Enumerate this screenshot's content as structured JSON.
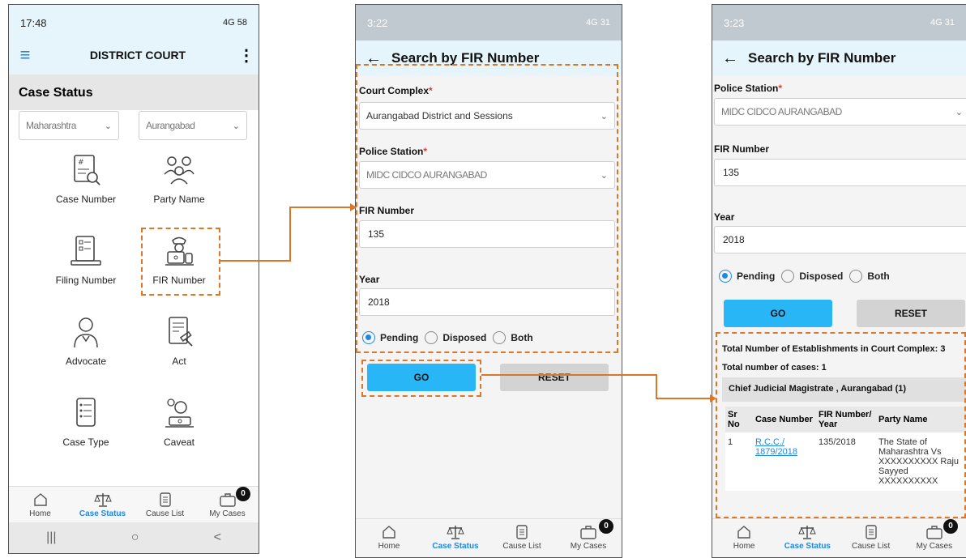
{
  "screen1": {
    "status_time": "17:48",
    "status_right": "4G 58",
    "app_title": "DISTRICT COURT",
    "section_title": "Case Status",
    "state_select": "Maharashtra",
    "district_select": "Aurangabad",
    "tiles": [
      {
        "label": "Case Number"
      },
      {
        "label": "Party Name"
      },
      {
        "label": "Filing Number"
      },
      {
        "label": "FIR Number"
      },
      {
        "label": "Advocate"
      },
      {
        "label": "Act"
      },
      {
        "label": "Case Type"
      },
      {
        "label": "Caveat"
      }
    ]
  },
  "nav": {
    "home": "Home",
    "case_status": "Case Status",
    "cause_list": "Cause List",
    "my_cases": "My Cases",
    "badge": "0"
  },
  "sysnav": {
    "recents": "|||",
    "home": "○",
    "back": "<"
  },
  "screen2": {
    "status_time": "3:22",
    "status_right": "4G 31",
    "title": "Search by FIR Number",
    "court_complex_label": "Court Complex",
    "court_complex_value": "Aurangabad District and Sessions",
    "police_station_label": "Police Station",
    "police_station_value": "MIDC CIDCO AURANGABAD",
    "fir_label": "FIR Number",
    "fir_value": "135",
    "year_label": "Year",
    "year_value": "2018",
    "radio_pending": "Pending",
    "radio_disposed": "Disposed",
    "radio_both": "Both",
    "go": "GO",
    "reset": "RESET"
  },
  "screen3": {
    "status_time": "3:23",
    "status_right": "4G 31",
    "title": "Search by FIR Number",
    "police_station_label": "Police Station",
    "police_station_value": "MIDC CIDCO AURANGABAD",
    "fir_label": "FIR Number",
    "fir_value": "135",
    "year_label": "Year",
    "year_value": "2018",
    "radio_pending": "Pending",
    "radio_disposed": "Disposed",
    "radio_both": "Both",
    "go": "GO",
    "reset": "RESET",
    "total_establishments": "Total Number of Establishments in Court Complex: 3",
    "total_cases": "Total number of cases: 1",
    "establishment": "Chief Judicial Magistrate , Aurangabad (1)",
    "table_headers": {
      "sr": "Sr No",
      "case": "Case Number",
      "fir": "FIR Number/ Year",
      "party": "Party Name"
    },
    "row": {
      "sr": "1",
      "case": "R.C.C./ 1879/2018",
      "fir": "135/2018",
      "party": "The State of Maharashtra Vs XXXXXXXXXX Raju Sayyed XXXXXXXXXX"
    }
  },
  "colors": {
    "accent": "#1e88e5",
    "go_button": "#29b6f6",
    "highlight": "#d9772b",
    "appbar": "#e5f5fb"
  }
}
